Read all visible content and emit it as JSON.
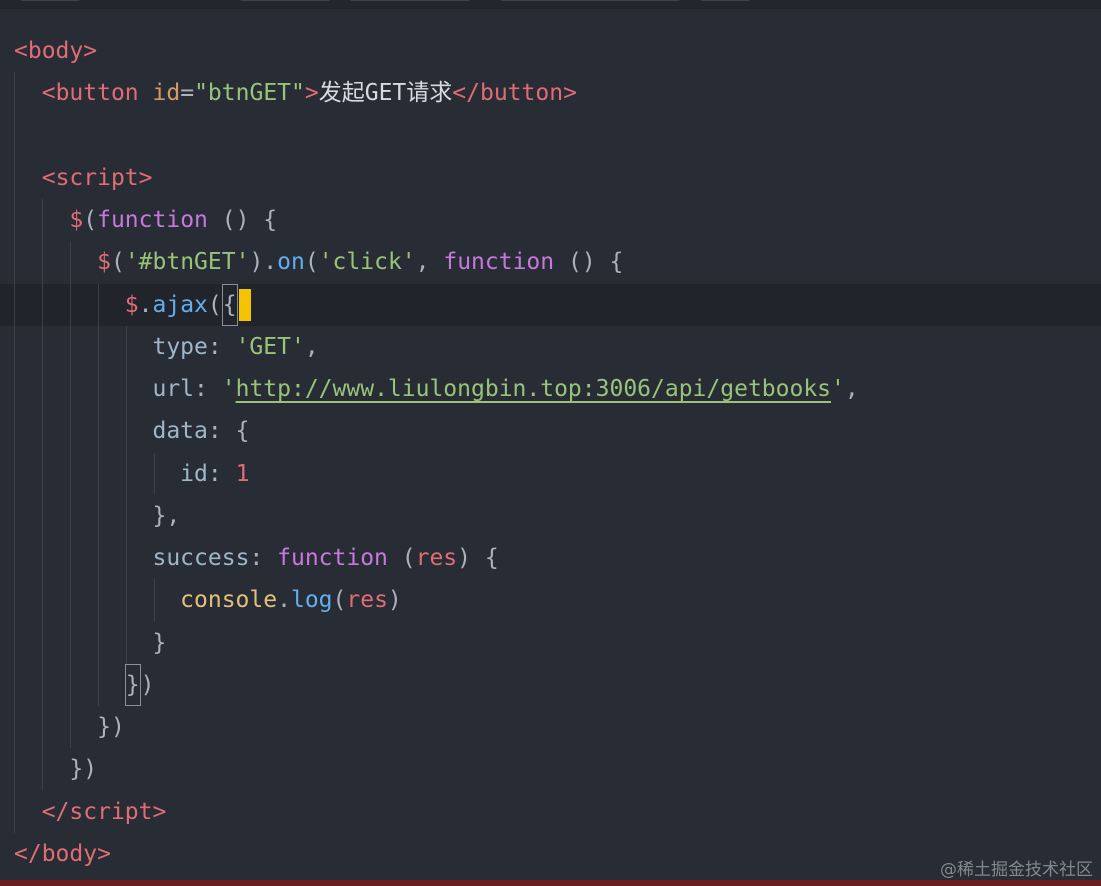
{
  "code": {
    "lines": [
      [
        "<",
        "body",
        ">"
      ],
      [
        "<",
        "button",
        " ",
        "id",
        "=",
        "\"btnGET\"",
        ">",
        "发起GET请求",
        "</",
        "button",
        ">"
      ],
      [],
      [
        "<",
        "script",
        ">"
      ],
      [
        "$",
        "(",
        "function",
        " () {"
      ],
      [
        "$",
        "(",
        "'#btnGET'",
        ").",
        "on",
        "(",
        "'click'",
        ", ",
        "function",
        " () {"
      ],
      [
        "$",
        ".",
        "ajax",
        "(",
        "{"
      ],
      [
        "type",
        ": ",
        "'GET'",
        ","
      ],
      [
        "url",
        ": ",
        "'",
        "http://www.liulongbin.top:3006/api/getbooks",
        "'",
        ","
      ],
      [
        "data",
        ": {"
      ],
      [
        "id",
        ": ",
        "1"
      ],
      [
        "},"
      ],
      [
        "success",
        ": ",
        "function",
        " (",
        "res",
        ") {"
      ],
      [
        "console",
        ".",
        "log",
        "(",
        "res",
        ")"
      ],
      [
        "}"
      ],
      [
        "}",
        ")"
      ],
      [
        "})"
      ],
      [
        "})"
      ],
      [
        "</",
        "script",
        ">"
      ],
      [
        "</",
        "body",
        ">"
      ]
    ]
  },
  "watermark": "@稀土掘金技术社区",
  "colors": {
    "background": "#282c34",
    "tag": "#e06c75",
    "attribute": "#d19a66",
    "string": "#98c379",
    "keyword": "#c678dd",
    "function": "#61afef",
    "cursor": "#f5c400"
  }
}
